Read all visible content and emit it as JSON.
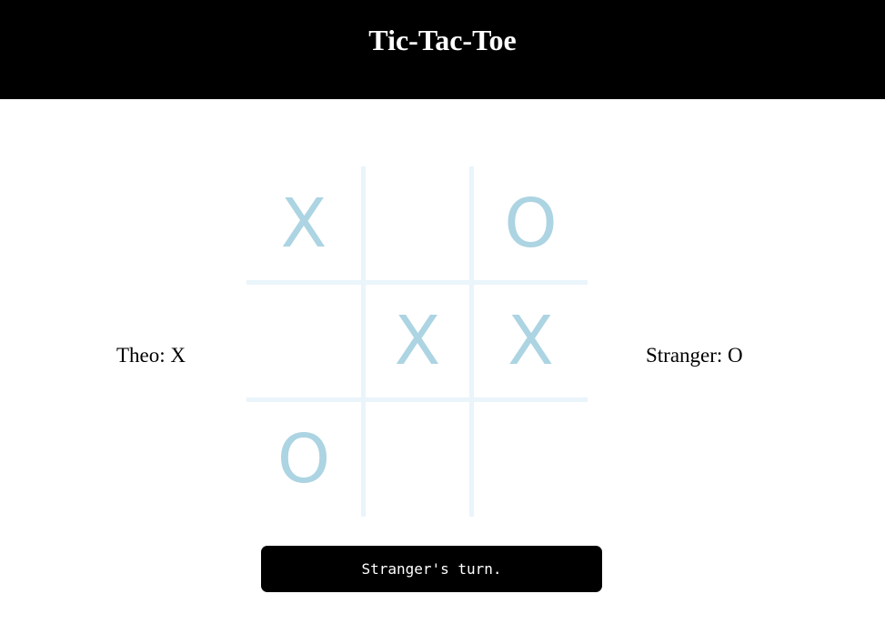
{
  "header": {
    "title": "Tic-Tac-Toe"
  },
  "players": {
    "left": "Theo: X",
    "right": "Stranger: O"
  },
  "board": {
    "cells": [
      "X",
      "",
      "O",
      "",
      "X",
      "X",
      "O",
      "",
      ""
    ],
    "mark_color": "#acd4e2",
    "grid_color": "#eaf4fb"
  },
  "status": {
    "text": "Stranger's turn."
  }
}
